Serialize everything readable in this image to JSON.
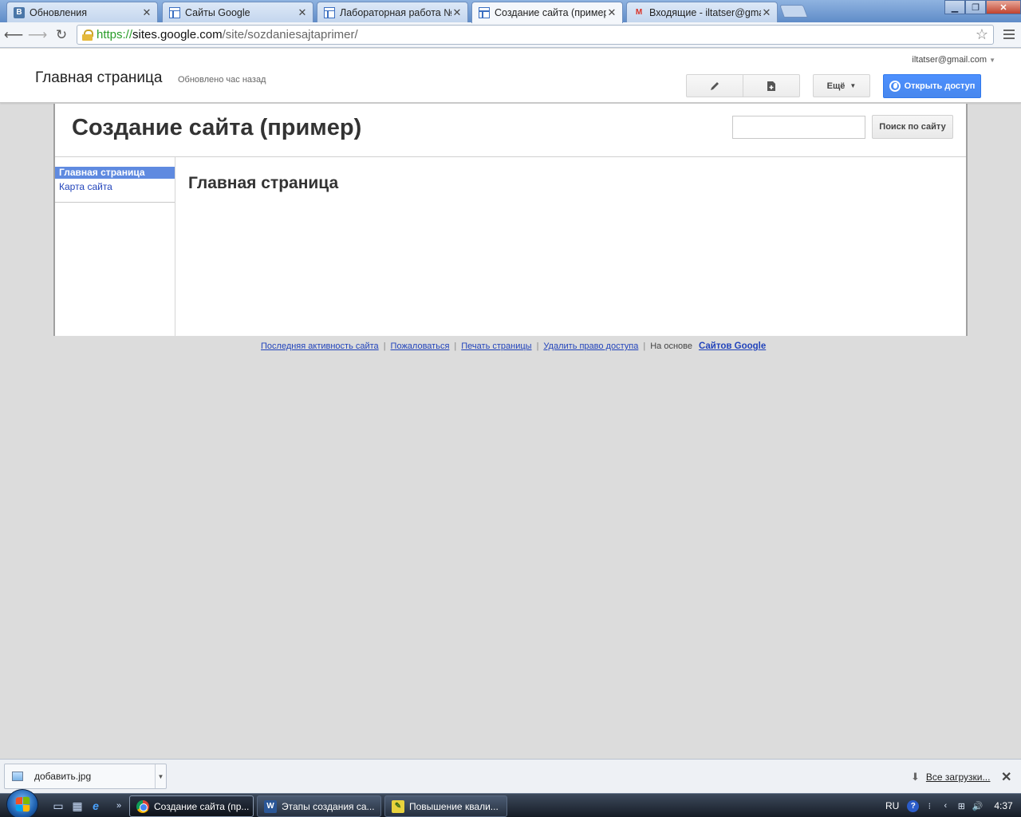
{
  "browser": {
    "tabs": [
      {
        "title": "Обновления",
        "icon": "vk-icon",
        "active": false
      },
      {
        "title": "Сайты Google",
        "icon": "google-sites-icon",
        "active": false
      },
      {
        "title": "Лабораторная работа №",
        "icon": "google-sites-icon",
        "active": false
      },
      {
        "title": "Создание сайта (пример)",
        "icon": "google-sites-icon",
        "active": true
      },
      {
        "title": "Входящие - iltatser@gma",
        "icon": "gmail-icon",
        "active": false
      }
    ],
    "url": {
      "scheme": "https://",
      "host": "sites.google.com",
      "path": "/site/sozdaniesajtaprimer/"
    }
  },
  "sites_header": {
    "page_name": "Главная страница",
    "updated": "Обновлено час назад",
    "account": "iltatser@gmail.com",
    "more_label": "Ещё",
    "share_label": "Открыть доступ",
    "accent_color": "#4d90fe"
  },
  "site": {
    "title": "Создание сайта (пример)",
    "search_button": "Поиск по сайту",
    "search_value": "",
    "nav": [
      {
        "label": "Главная страница",
        "current": true
      },
      {
        "label": "Карта сайта",
        "current": false
      }
    ],
    "page_heading": "Главная страница"
  },
  "footer": {
    "links": [
      "Последняя активность сайта",
      "Пожаловаться",
      "Печать страницы",
      "Удалить право доступа"
    ],
    "based_on": "На основе",
    "brand": "Сайтов Google"
  },
  "download_shelf": {
    "file_name": "добавить.jpg",
    "all_downloads": "Все загрузки..."
  },
  "taskbar": {
    "windows": [
      {
        "title": "Создание сайта (пр...",
        "icon": "chrome-icon",
        "active": true
      },
      {
        "title": "Этапы создания са...",
        "icon": "word-icon",
        "active": false
      },
      {
        "title": "Повышение квали...",
        "icon": "document-icon",
        "active": false
      }
    ],
    "language": "RU",
    "clock": "4:37"
  }
}
